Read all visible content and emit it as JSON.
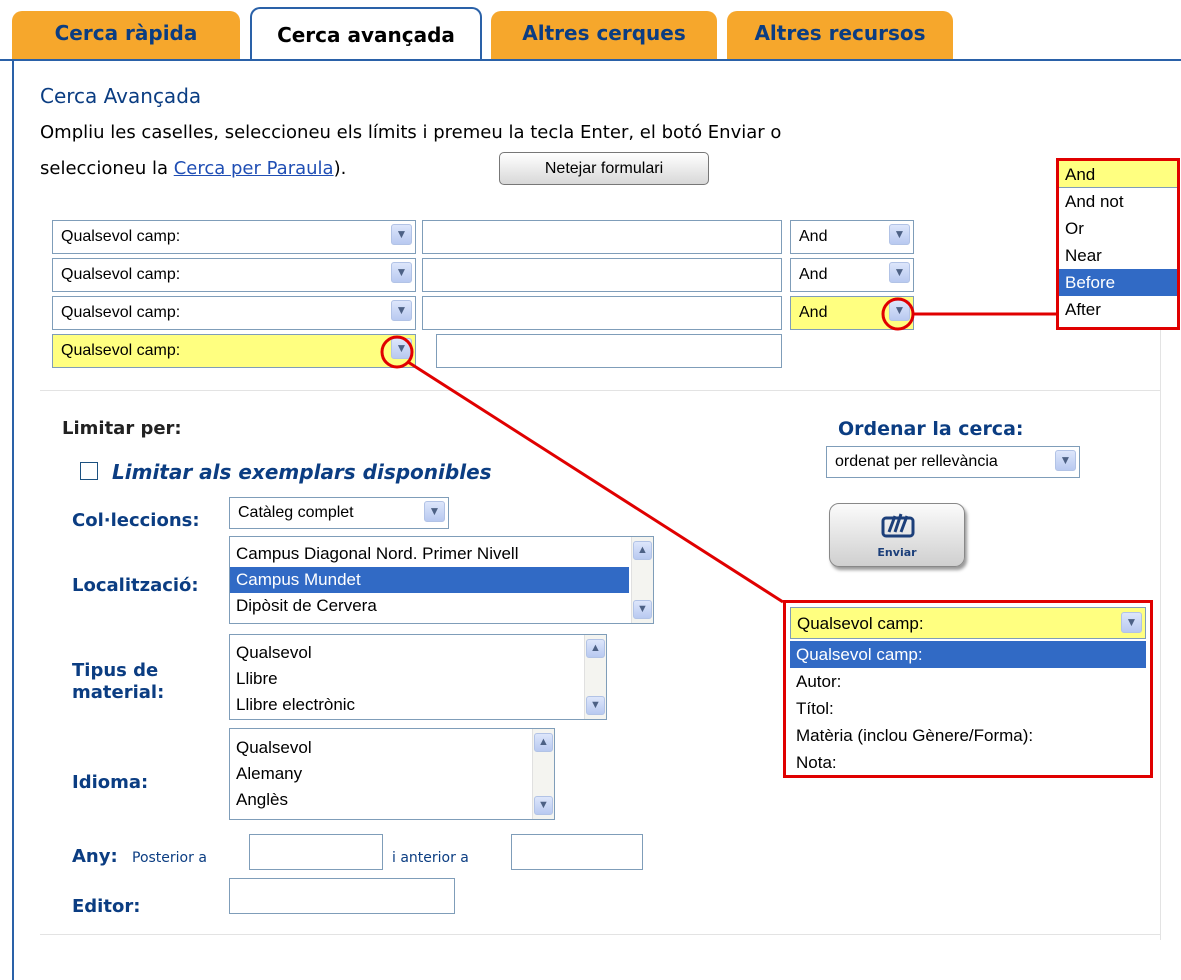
{
  "tabs": [
    {
      "label": "Cerca ràpida"
    },
    {
      "label": "Cerca avançada"
    },
    {
      "label": "Altres cerques"
    },
    {
      "label": "Altres recursos"
    }
  ],
  "heading": "Cerca Avançada",
  "intro": {
    "line1": "Ompliu les caselles, seleccioneu els límits i premeu la tecla Enter, el botó Enviar o",
    "line2_prefix": "seleccioneu la ",
    "link": "Cerca per Paraula",
    "line2_suffix": ")."
  },
  "clear_button": "Netejar formulari",
  "search_rows": [
    {
      "field": "Qualsevol camp:",
      "operator": "And"
    },
    {
      "field": "Qualsevol camp:",
      "operator": "And"
    },
    {
      "field": "Qualsevol camp:",
      "operator": "And"
    },
    {
      "field": "Qualsevol camp:"
    }
  ],
  "operator_dropdown": {
    "selected": "And",
    "options": [
      "And not",
      "Or",
      "Near",
      "Before",
      "After"
    ],
    "highlighted": "Before"
  },
  "field_dropdown": {
    "selected": "Qualsevol camp:",
    "options": [
      "Qualsevol camp:",
      "Autor:",
      "Títol:",
      "Matèria (inclou Gènere/Forma):",
      "Nota:"
    ],
    "highlighted": "Qualsevol camp:"
  },
  "limits": {
    "title": "Limitar per:",
    "available_label": "Limitar als exemplars disponibles",
    "collections_label": "Col·leccions:",
    "collections_value": "Catàleg complet",
    "location_label": "Localització:",
    "location_items": [
      "Campus Diagonal Nord. Primer Nivell",
      "Campus Mundet",
      "Dipòsit de Cervera"
    ],
    "material_label_1": "Tipus de",
    "material_label_2": "material:",
    "material_items": [
      "Qualsevol",
      "Llibre",
      "Llibre electrònic"
    ],
    "language_label": "Idioma:",
    "language_items": [
      "Qualsevol",
      "Alemany",
      "Anglès"
    ],
    "year_label": "Any:",
    "after_label": "Posterior a",
    "before_label": "i anterior a",
    "publisher_label": "Editor:"
  },
  "sort": {
    "title": "Ordenar la cerca:",
    "value": "ordenat per rellevància"
  },
  "submit_label": "Enviar",
  "colors": {
    "accent": "#f6a72c",
    "title": "#0b3d82",
    "highlight_yellow": "#ffff80",
    "callout": "#e00000"
  }
}
